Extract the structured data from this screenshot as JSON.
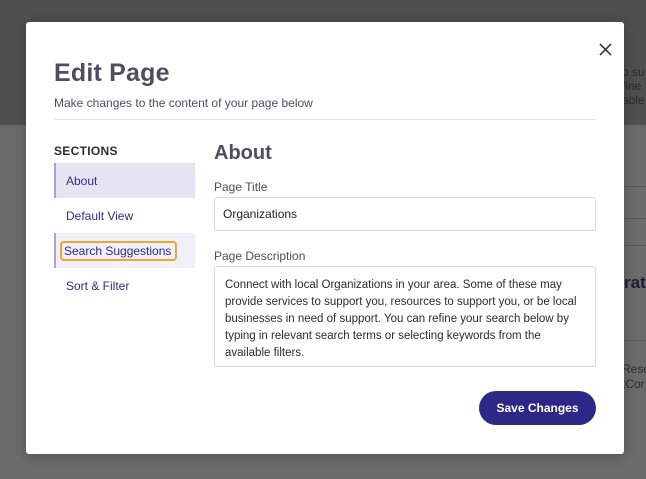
{
  "background": {
    "right_text_lines": [
      "o su",
      "fine",
      "able"
    ],
    "right_bold": "ratio",
    "right_text_lines_2": [
      "Reso",
      "tCor"
    ]
  },
  "modal": {
    "title": "Edit Page",
    "subtitle": "Make changes to the content of your page below",
    "close_icon": "close-icon"
  },
  "sidebar": {
    "heading": "SECTIONS",
    "items": [
      {
        "label": "About",
        "state": "active"
      },
      {
        "label": "Default View",
        "state": "normal"
      },
      {
        "label": "Search Suggestions",
        "state": "focused"
      },
      {
        "label": "Sort & Filter",
        "state": "normal"
      }
    ]
  },
  "main": {
    "section_title": "About",
    "page_title_label": "Page Title",
    "page_title_value": "Organizations",
    "page_description_label": "Page Description",
    "page_description_value": "Connect with local Organizations in your area. Some of these may provide services to support you, resources to support you, or be local businesses in need of support. You can refine your search below by typing in relevant search terms or selecting keywords from the available filters."
  },
  "actions": {
    "save_label": "Save Changes"
  },
  "colors": {
    "accent": "#2d2785",
    "focus_ring": "#e8a931",
    "active_bg": "#e6e4f3"
  }
}
